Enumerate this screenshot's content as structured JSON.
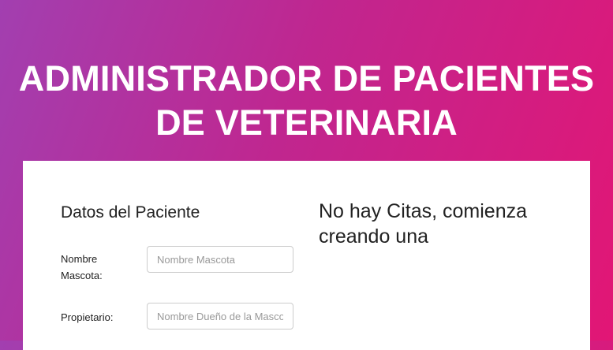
{
  "header": {
    "title_line1": "ADMINISTRADOR DE PACIENTES",
    "title_line2": "DE VETERINARIA"
  },
  "form": {
    "title": "Datos del Paciente",
    "fields": [
      {
        "label": "Nombre Mascota:",
        "placeholder": "Nombre Mascota"
      },
      {
        "label": "Propietario:",
        "placeholder": "Nombre Dueño de la Mascota"
      }
    ]
  },
  "appointments": {
    "empty_message": "No hay Citas, comienza creando una"
  }
}
